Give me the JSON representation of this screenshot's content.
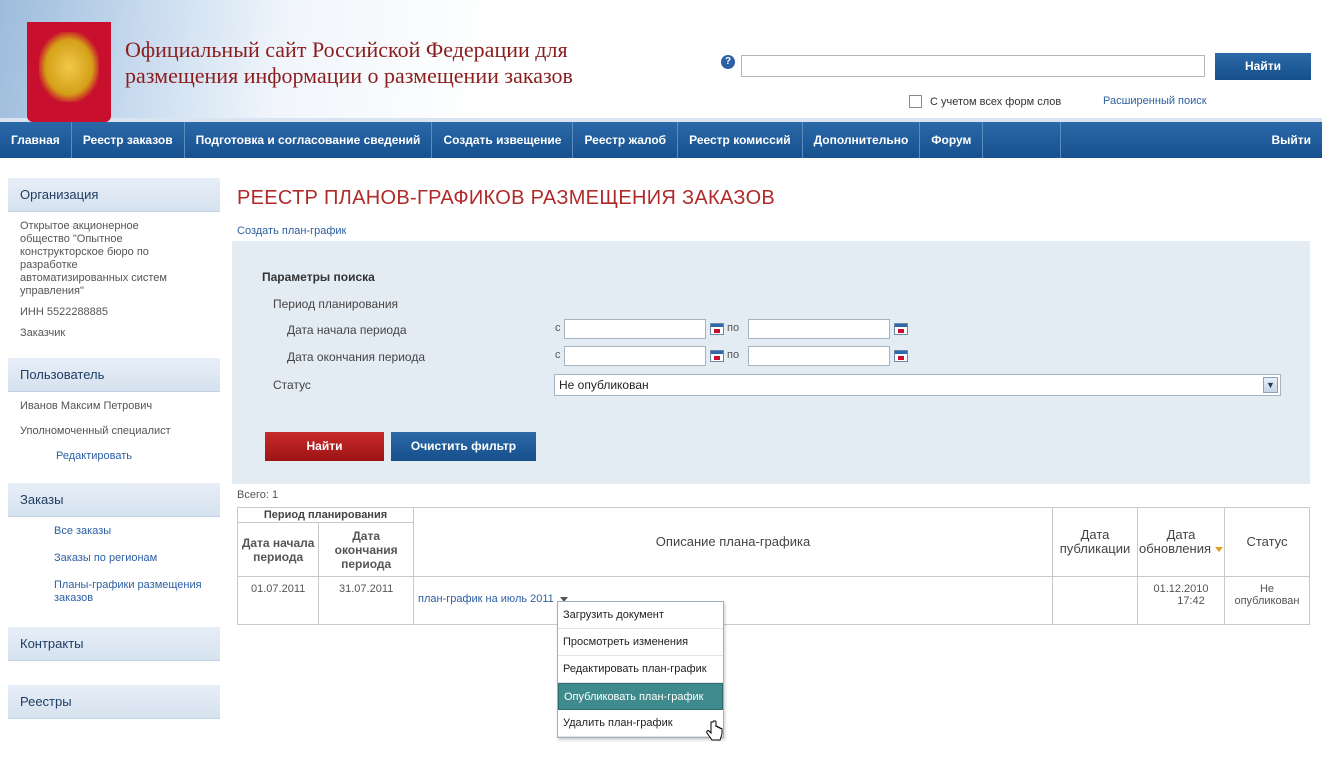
{
  "header": {
    "title_line1": "Официальный сайт Российской Федерации для",
    "title_line2": "размещения информации о размещении заказов",
    "help_glyph": "?",
    "search_value": "",
    "search_button": "Найти",
    "all_forms_label": "С учетом всех форм слов",
    "advanced_search": "Расширенный поиск"
  },
  "nav": {
    "items": [
      "Главная",
      "Реестр заказов",
      "Подготовка и согласование сведений",
      "Создать извещение",
      "Реестр жалоб",
      "Реестр комиссий",
      "Дополнительно",
      "Форум"
    ],
    "logout": "Выйти"
  },
  "sidebar": {
    "org_head": "Организация",
    "org_name": "Открытое акционерное общество \"Опытное конструкторское бюро по разработке автоматизированных систем управления\"",
    "inn": "ИНН 5522288885",
    "role": "Заказчик",
    "user_head": "Пользователь",
    "user_name": "Иванов Максим Петрович",
    "user_role": "Уполномоченный специалист",
    "edit_link": "Редактировать",
    "orders_head": "Заказы",
    "orders_all": "Все заказы",
    "orders_regions": "Заказы по регионам",
    "orders_plans": "Планы-графики размещения заказов",
    "contracts_head": "Контракты",
    "registries_head": "Реестры"
  },
  "main": {
    "page_title": "РЕЕСТР ПЛАНОВ-ГРАФИКОВ РАЗМЕЩЕНИЯ ЗАКАЗОВ",
    "create_link": "Создать план-график"
  },
  "filter": {
    "title": "Параметры поиска",
    "period_label": "Период планирования",
    "start_label": "Дата начала периода",
    "end_label": "Дата окончания периода",
    "from": "с",
    "to": "по",
    "status_label": "Статус",
    "status_value": "Не опубликован",
    "find_button": "Найти",
    "clear_button": "Очистить фильтр"
  },
  "results": {
    "total": "Всего: 1",
    "group_header": "Период планирования",
    "col_start": "Дата начала периода",
    "col_end": "Дата окончания периода",
    "col_desc": "Описание плана-графика",
    "col_pub": "Дата публикации",
    "col_upd": "Дата обновления",
    "col_status": "Статус",
    "rows": [
      {
        "start": "01.07.2011",
        "end": "31.07.2011",
        "desc": "план-график на июль 2011",
        "pub": "",
        "upd_date": "01.12.2010",
        "upd_time": "17:42",
        "status_1": "Не",
        "status_2": "опубликован"
      }
    ]
  },
  "context_menu": {
    "items": [
      "Загрузить документ",
      "Просмотреть изменения",
      "Редактировать план-график",
      "Опубликовать план-график",
      "Удалить план-график"
    ],
    "active_index": 3
  },
  "colors": {
    "nav_blue": "#1f5c9c",
    "title_red": "#b02a2a",
    "link_blue": "#2c5fa3",
    "filter_bg": "#e3ebf3",
    "menu_active": "#3f8a8c"
  }
}
